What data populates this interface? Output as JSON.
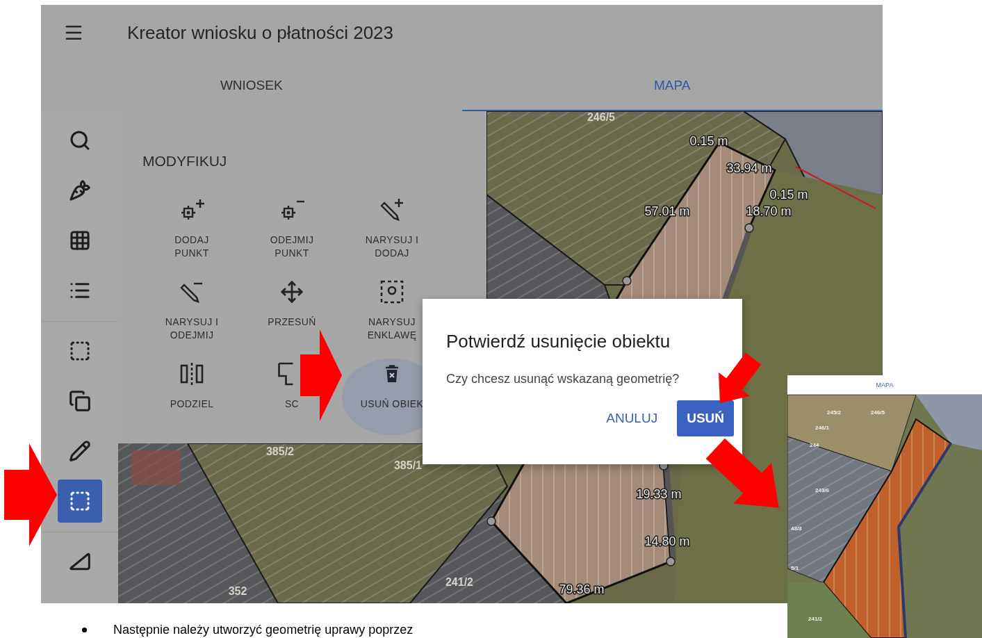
{
  "app": {
    "title": "Kreator wniosku o płatności 2023",
    "tabs": [
      {
        "label": "WNIOSEK",
        "selected": false
      },
      {
        "label": "MAPA",
        "selected": true
      }
    ],
    "rail_groups": [
      [
        {
          "selected": false
        },
        {
          "selected": false
        },
        {
          "selected": false
        },
        {
          "selected": false
        }
      ],
      [
        {
          "selected": false
        },
        {
          "selected": false
        },
        {
          "selected": false
        },
        {
          "selected": true
        }
      ],
      [
        {
          "selected": false
        }
      ]
    ],
    "panel": {
      "title": "MODYFIKUJ",
      "tools": [
        {
          "label": "DODAJ\nPUNKT",
          "selected": false
        },
        {
          "label": "ODEJMIJ\nPUNKT",
          "selected": false
        },
        {
          "label": "NARYSUJ I\nDODAJ",
          "selected": false
        },
        {
          "label": "NARYSUJ I\nODEJMIJ",
          "selected": false
        },
        {
          "label": "PRZESUŃ",
          "selected": false
        },
        {
          "label": "NARYSUJ\nENKLAWĘ",
          "selected": false
        },
        {
          "label": "PODZIEL",
          "selected": false
        },
        {
          "label": "SC",
          "selected": false
        },
        {
          "label": "USUŃ OBIEK",
          "selected": true
        }
      ]
    },
    "map_labels": [
      {
        "text": "246/5",
        "kind": "parcel"
      },
      {
        "text": "0.15 m",
        "kind": "distance"
      },
      {
        "text": "33.94 m",
        "kind": "distance"
      },
      {
        "text": "0.15 m",
        "kind": "distance"
      },
      {
        "text": "57.01 m",
        "kind": "distance"
      },
      {
        "text": "18.70 m",
        "kind": "distance"
      },
      {
        "text": "385/2",
        "kind": "parcel"
      },
      {
        "text": "385/1",
        "kind": "parcel"
      },
      {
        "text": "19.33 m",
        "kind": "distance"
      },
      {
        "text": "14.80 m",
        "kind": "distance"
      },
      {
        "text": "352",
        "kind": "parcel"
      },
      {
        "text": "241/2",
        "kind": "parcel"
      },
      {
        "text": "79.36 m",
        "kind": "distance"
      }
    ]
  },
  "dialog": {
    "title": "Potwierdź usunięcie obiektu",
    "message": "Czy chcesz usunąć wskazaną geometrię?",
    "buttons": [
      {
        "label": "ANULUJ",
        "kind": "text"
      },
      {
        "label": "USUŃ",
        "kind": "contained"
      }
    ]
  },
  "inset": {
    "tab": "MAPA",
    "labels": [
      "245/2",
      "246/5",
      "246/1",
      "244",
      "243/6",
      "43/3",
      "5/1",
      "241/2"
    ]
  },
  "document": {
    "bullet": "Następnie należy utworzyć geometrię uprawy poprzez"
  }
}
